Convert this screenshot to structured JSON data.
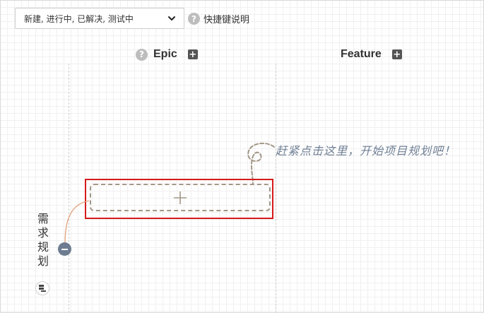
{
  "filter": {
    "value": "新建, 进行中, 已解决, 测试中"
  },
  "shortcut": {
    "help_glyph": "?",
    "label": "快捷键说明"
  },
  "columns": [
    {
      "title": "Epic",
      "help_glyph": "?",
      "add_glyph": "+"
    },
    {
      "title": "Feature",
      "add_glyph": "+"
    }
  ],
  "hint": {
    "text": "赶紧点击这里，开始项目规划吧！"
  },
  "tree": {
    "root_label": "需求规划"
  },
  "colors": {
    "highlight": "#d61a1a",
    "hint": "#6f7f94",
    "dashed_card": "#a39787",
    "collapse": "#6d7c90"
  },
  "icons": [
    "chevron-down-icon",
    "help-icon",
    "plus-square-icon",
    "plus-icon",
    "swirl-arrow-icon",
    "minus-icon",
    "layers-icon"
  ]
}
